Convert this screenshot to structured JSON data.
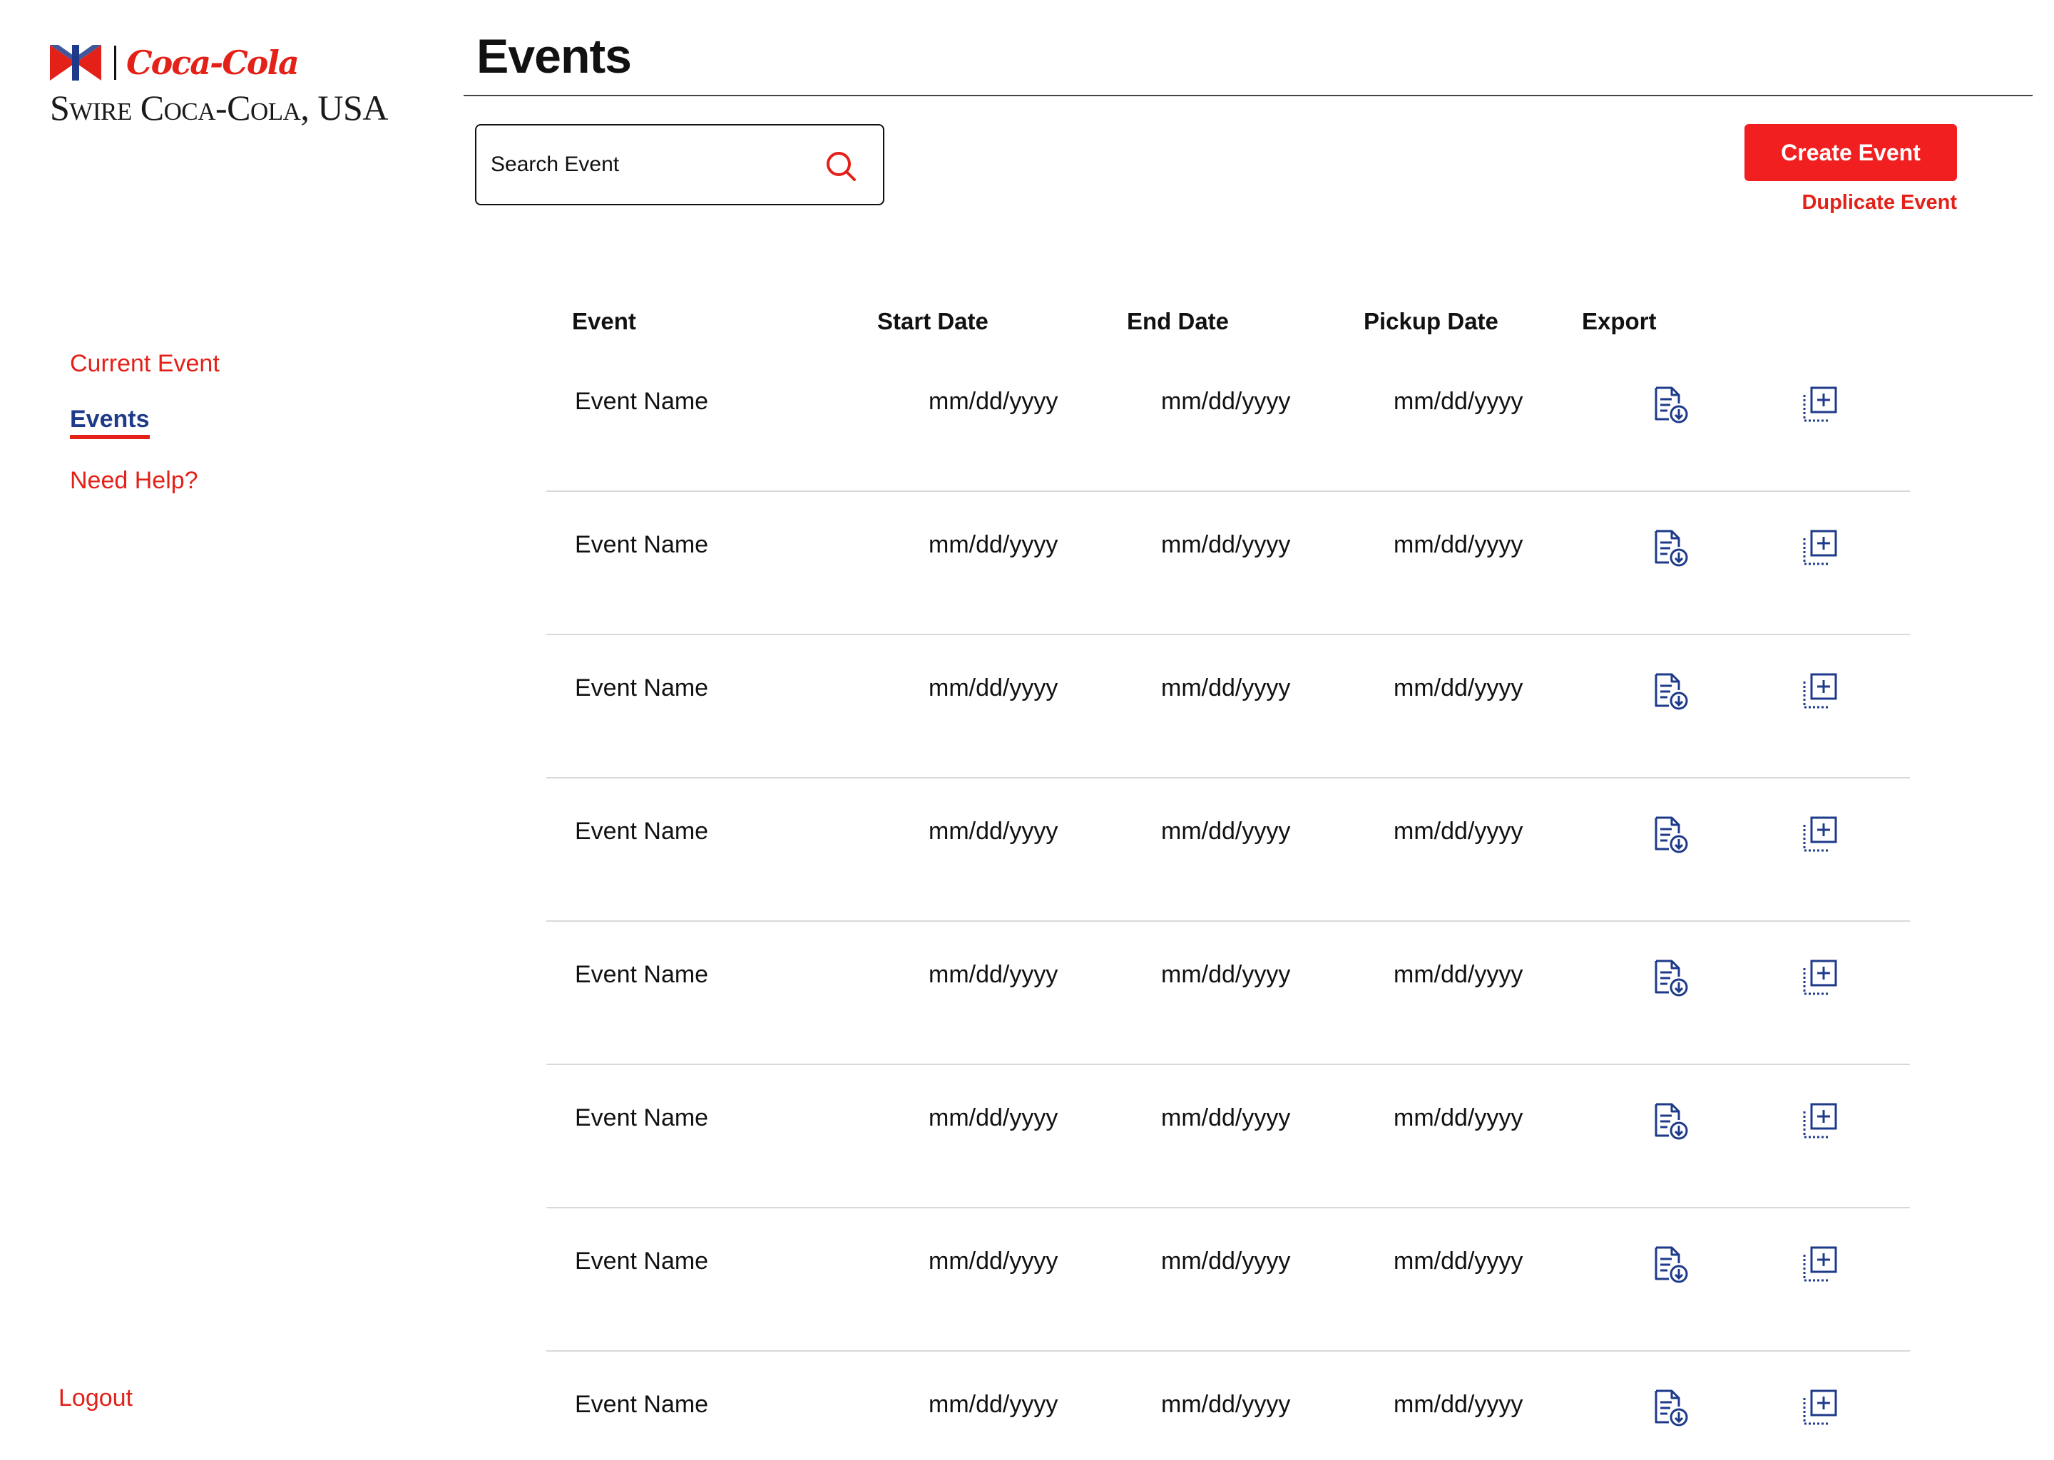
{
  "brand": {
    "script_text": "Coca-Cola",
    "company_text": "Swire Coca-Cola, USA"
  },
  "colors": {
    "accent_red": "#f11f1f",
    "brand_red": "#e32119",
    "navy": "#1e3a8a"
  },
  "sidebar": {
    "items": [
      {
        "label": "Current Event",
        "active": false
      },
      {
        "label": "Events",
        "active": true
      },
      {
        "label": "Need Help?",
        "active": false
      }
    ],
    "logout_label": "Logout"
  },
  "header": {
    "title": "Events"
  },
  "search": {
    "placeholder": "Search Event",
    "icon": "search-icon"
  },
  "actions": {
    "create_label": "Create Event",
    "duplicate_label": "Duplicate Event"
  },
  "table": {
    "columns": [
      "Event",
      "Start Date",
      "End Date",
      "Pickup Date",
      "Export"
    ],
    "export_icon": "file-export-icon",
    "duplicate_icon": "duplicate-add-icon",
    "rows": [
      {
        "name": "Event Name",
        "start": "mm/dd/yyyy",
        "end": "mm/dd/yyyy",
        "pickup": "mm/dd/yyyy"
      },
      {
        "name": "Event Name",
        "start": "mm/dd/yyyy",
        "end": "mm/dd/yyyy",
        "pickup": "mm/dd/yyyy"
      },
      {
        "name": "Event Name",
        "start": "mm/dd/yyyy",
        "end": "mm/dd/yyyy",
        "pickup": "mm/dd/yyyy"
      },
      {
        "name": "Event Name",
        "start": "mm/dd/yyyy",
        "end": "mm/dd/yyyy",
        "pickup": "mm/dd/yyyy"
      },
      {
        "name": "Event Name",
        "start": "mm/dd/yyyy",
        "end": "mm/dd/yyyy",
        "pickup": "mm/dd/yyyy"
      },
      {
        "name": "Event Name",
        "start": "mm/dd/yyyy",
        "end": "mm/dd/yyyy",
        "pickup": "mm/dd/yyyy"
      },
      {
        "name": "Event Name",
        "start": "mm/dd/yyyy",
        "end": "mm/dd/yyyy",
        "pickup": "mm/dd/yyyy"
      },
      {
        "name": "Event Name",
        "start": "mm/dd/yyyy",
        "end": "mm/dd/yyyy",
        "pickup": "mm/dd/yyyy"
      }
    ]
  }
}
